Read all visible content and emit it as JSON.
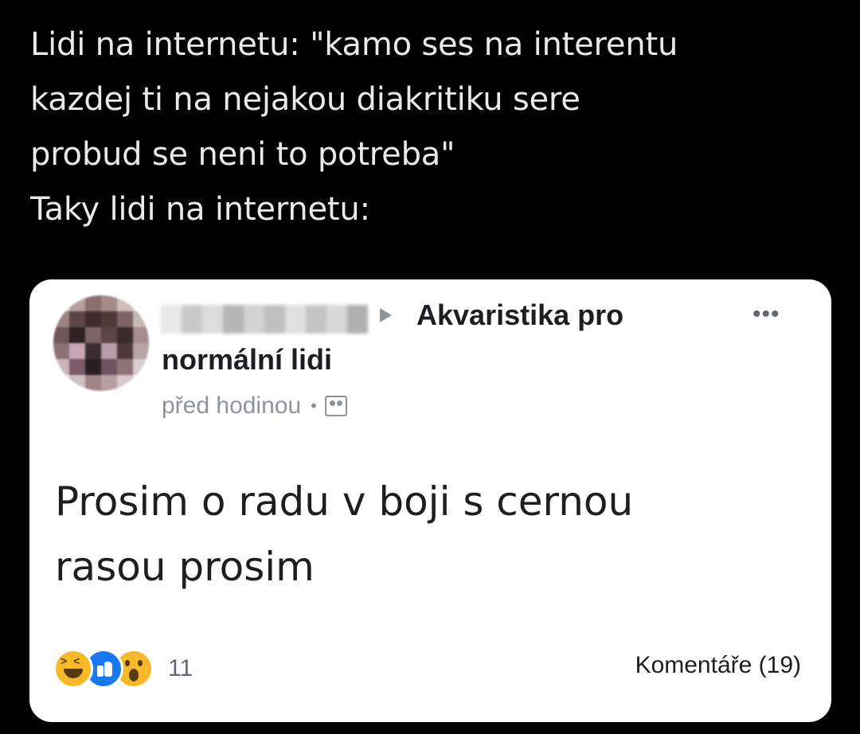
{
  "tweet": {
    "lines": [
      "Lidi na internetu: \"kamo ses na interentu",
      "kazdej ti na nejakou diakritiku sere",
      "probud se neni to potreba\"",
      "Taky lidi na internetu:"
    ]
  },
  "post": {
    "group_line1": "Akvaristika pro",
    "group_line2": "normální lidi",
    "timestamp": "před hodinou",
    "separator": "•",
    "more_label": "•••",
    "body_lines": [
      "Prosim o radu v boji s cernou",
      "rasou prosim"
    ],
    "reactions": [
      "haha",
      "like",
      "wow"
    ],
    "reaction_count": "11",
    "comments_label": "Komentáře (19)",
    "colors": {
      "like": "#1877f2",
      "emoji": "#f7b928",
      "card_bg": "#ffffff",
      "page_bg": "#000000"
    }
  }
}
